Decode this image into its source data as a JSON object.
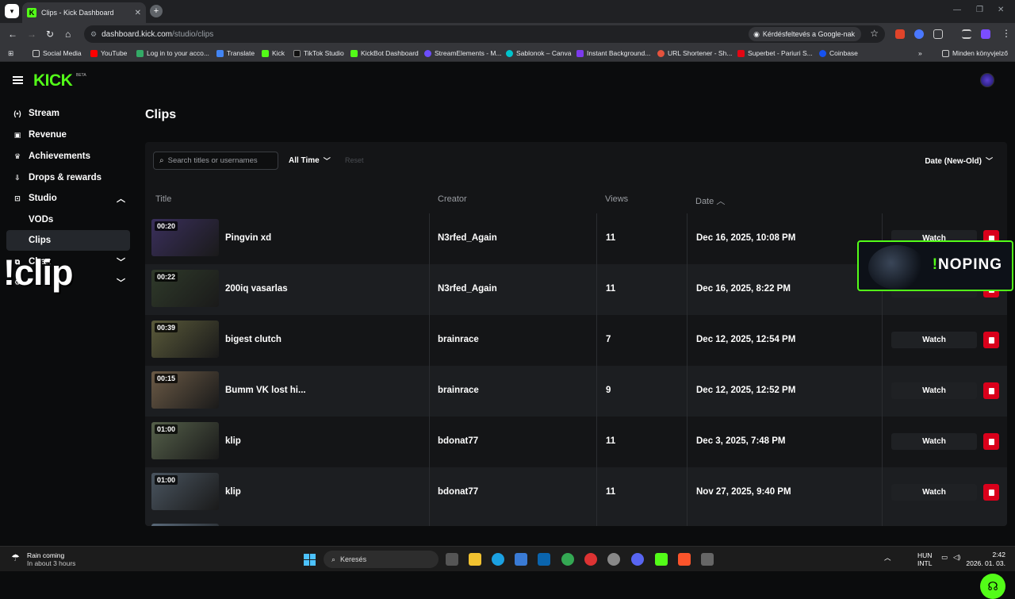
{
  "browser": {
    "tab_title": "Clips - Kick Dashboard",
    "url_host": "dashboard.kick.com",
    "url_path": "/studio/clips",
    "google_button": "Kérdésfeltevés a Google-nak",
    "bookmarks": [
      "Social Media",
      "YouTube",
      "Log in to your acco...",
      "Translate",
      "Kick",
      "TikTok Studio",
      "KickBot Dashboard",
      "StreamElements - M...",
      "Sablonok – Canva",
      "Instant Background...",
      "URL Shortener - Sh...",
      "Superbet - Pariuri S...",
      "Coinbase"
    ],
    "bookmarks_all": "Minden könyvjelző"
  },
  "app": {
    "logo": "KICK",
    "beta": "BETA",
    "page_title": "Clips",
    "sidebar": [
      {
        "label": "Stream",
        "icon": "broadcast-icon"
      },
      {
        "label": "Revenue",
        "icon": "revenue-icon"
      },
      {
        "label": "Achievements",
        "icon": "trophy-icon"
      },
      {
        "label": "Drops & rewards",
        "icon": "drops-icon"
      },
      {
        "label": "Studio",
        "icon": "studio-icon"
      },
      {
        "label": "VODs"
      },
      {
        "label": "Clips"
      },
      {
        "label": "Chan",
        "icon": "channel-icon"
      },
      {
        "label": "",
        "icon": "settings-icon"
      }
    ],
    "overlay_text": "!clip",
    "filters": {
      "search_placeholder": "Search titles or usernames",
      "time": "All Time",
      "reset": "Reset",
      "sort": "Date (New-Old)"
    },
    "columns": {
      "title": "Title",
      "creator": "Creator",
      "views": "Views",
      "date": "Date"
    },
    "watch_label": "Watch",
    "clips": [
      {
        "duration": "00:20",
        "title": "Pingvin xd",
        "creator": "N3rfed_Again",
        "views": "11",
        "date": "Dec 16, 2025, 10:08 PM",
        "thumb": "#3a2f5c"
      },
      {
        "duration": "00:22",
        "title": "200iq vasarlas",
        "creator": "N3rfed_Again",
        "views": "11",
        "date": "Dec 16, 2025, 8:22 PM",
        "thumb": "#2f3a2a"
      },
      {
        "duration": "00:39",
        "title": "bigest clutch",
        "creator": "brainrace",
        "views": "7",
        "date": "Dec 12, 2025, 12:54 PM",
        "thumb": "#5a5a3a"
      },
      {
        "duration": "00:15",
        "title": "Bumm VK lost hi...",
        "creator": "brainrace",
        "views": "9",
        "date": "Dec 12, 2025, 12:52 PM",
        "thumb": "#6b5a46"
      },
      {
        "duration": "01:00",
        "title": "klip",
        "creator": "bdonat77",
        "views": "11",
        "date": "Dec 3, 2025, 7:48 PM",
        "thumb": "#55604a"
      },
      {
        "duration": "01:00",
        "title": "klip",
        "creator": "bdonat77",
        "views": "11",
        "date": "Nov 27, 2025, 9:40 PM",
        "thumb": "#4a5560"
      }
    ],
    "noping": {
      "excl": "!",
      "text": "NOPING"
    }
  },
  "taskbar": {
    "weather_title": "Rain coming",
    "weather_sub": "In about 3 hours",
    "search": "Keresés",
    "lang1": "HUN",
    "lang2": "INTL",
    "time": "2:42",
    "date": "2026. 01. 03."
  }
}
